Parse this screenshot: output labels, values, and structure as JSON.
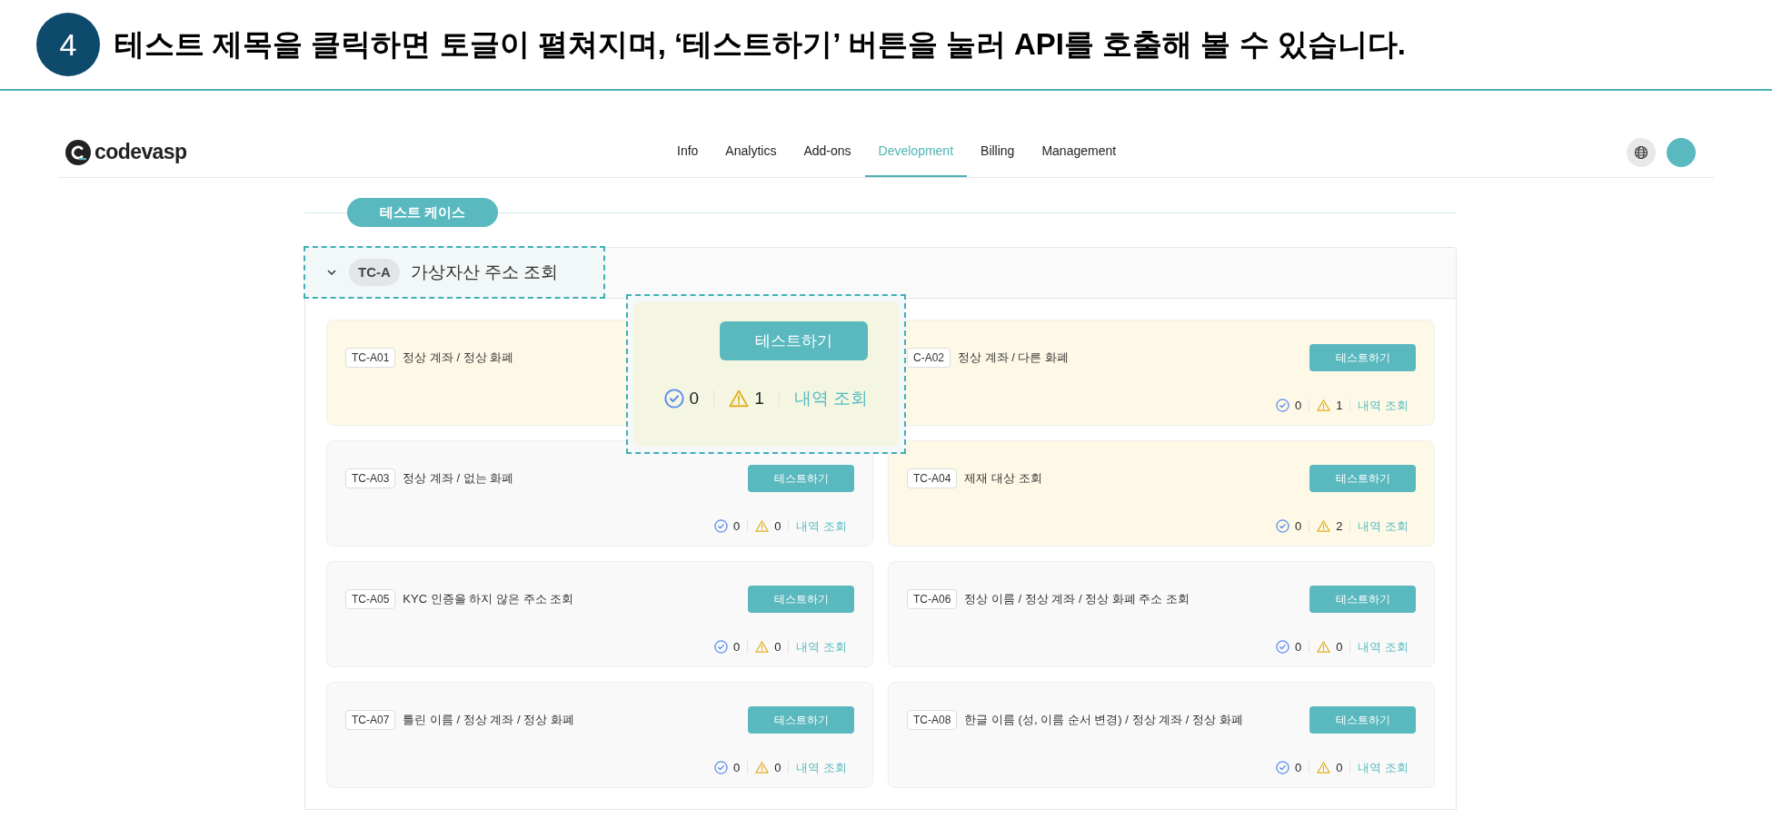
{
  "step": {
    "number": "4",
    "title": "테스트 제목을 클릭하면 토글이 펼쳐지며, ‘테스트하기’ 버튼을 눌러 API를 호출해 볼 수 있습니다."
  },
  "navbar": {
    "logo": "codevasp",
    "items": [
      {
        "label": "Info",
        "selected": false
      },
      {
        "label": "Analytics",
        "selected": false
      },
      {
        "label": "Add-ons",
        "selected": false
      },
      {
        "label": "Development",
        "selected": true
      },
      {
        "label": "Billing",
        "selected": false
      },
      {
        "label": "Management",
        "selected": false
      }
    ]
  },
  "section": {
    "label": "테스트 케이스"
  },
  "group": {
    "code": "TC-A",
    "title": "가상자산 주소 조회",
    "expanded": true
  },
  "callout": {
    "button": "테스트하기",
    "passed": "0",
    "warnings": "1",
    "history": "내역 조회"
  },
  "cards": [
    {
      "id": "TC-A01",
      "title": "정상 계좌 / 정상 화폐",
      "highlighted": true
    },
    {
      "id": "C-A02",
      "title": "정상 계좌 / 다른 화폐",
      "highlighted": true,
      "button": "테스트하기",
      "passed": "0",
      "warnings": "1",
      "history": "내역 조회"
    },
    {
      "id": "TC-A03",
      "title": "정상 계좌 / 없는 화폐",
      "highlighted": false,
      "button": "테스트하기",
      "passed": "0",
      "warnings": "0",
      "history": "내역 조회"
    },
    {
      "id": "TC-A04",
      "title": "제재 대상 조회",
      "highlighted": true,
      "button": "테스트하기",
      "passed": "0",
      "warnings": "2",
      "history": "내역 조회"
    },
    {
      "id": "TC-A05",
      "title": "KYC 인증을 하지 않은 주소 조회",
      "highlighted": false,
      "button": "테스트하기",
      "passed": "0",
      "warnings": "0",
      "history": "내역 조회"
    },
    {
      "id": "TC-A06",
      "title": "정상 이름 / 정상 계좌 / 정상 화폐 주소 조회",
      "highlighted": false,
      "button": "테스트하기",
      "passed": "0",
      "warnings": "0",
      "history": "내역 조회"
    },
    {
      "id": "TC-A07",
      "title": "틀린 이름 / 정상 계좌 / 정상 화폐",
      "highlighted": false,
      "button": "테스트하기",
      "passed": "0",
      "warnings": "0",
      "history": "내역 조회"
    },
    {
      "id": "TC-A08",
      "title": "한글 이름 (성, 이름 순서 변경) / 정상 계좌 / 정상 화폐",
      "highlighted": false,
      "button": "테스트하기",
      "passed": "0",
      "warnings": "0",
      "history": "내역 조회"
    }
  ]
}
